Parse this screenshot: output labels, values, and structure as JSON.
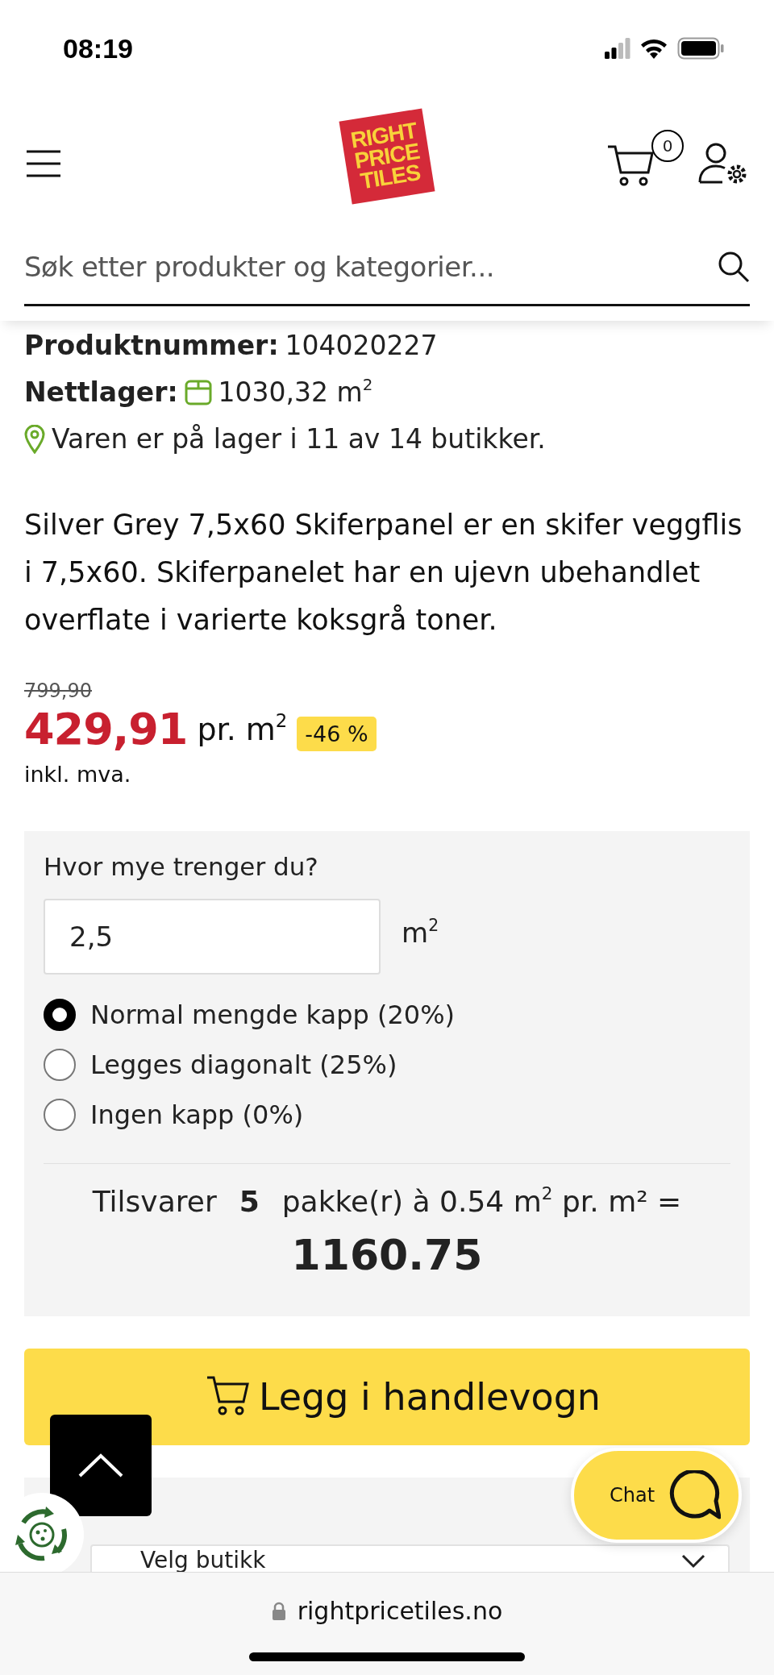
{
  "status_bar": {
    "time": "08:19"
  },
  "header": {
    "logo_lines": [
      "RIGHT",
      "PRICE",
      "TILES"
    ],
    "cart_count": "0"
  },
  "search": {
    "placeholder": "Søk etter produkter og kategorier..."
  },
  "product": {
    "number_label": "Produktnummer:",
    "number": "104020227",
    "stock_label": "Nettlager:",
    "stock": "1030,32 m$^{2}$",
    "availability": "Varen er på lager i 11 av 14 butikker.",
    "description": "Silver Grey 7,5x60 Skiferpanel er en skifer veggflis i 7,5x60. Skiferpanelet har en ujevn ubehandlet overflate i varierte koksgrå toner."
  },
  "price": {
    "old": "799,90",
    "current": "429,91",
    "unit": "pr. m$^{2}$",
    "discount": "-46 %",
    "vat_note": "inkl. mva."
  },
  "calculator": {
    "question": "Hvor mye trenger du?",
    "quantity": "2,5",
    "unit": "m$^{2}$",
    "options": [
      {
        "label": "Normal mengde kapp (20%)",
        "selected": true
      },
      {
        "label": "Legges diagonalt (25%)",
        "selected": false
      },
      {
        "label": "Ingen kapp (0%)",
        "selected": false
      }
    ],
    "result_prefix": "Tilsvarer",
    "packages": "5",
    "result_suffix": "pakke(r) à 0.54 m$^{2}$ pr. m² =",
    "total": "1160.75"
  },
  "add_to_cart": {
    "label": "Legg i handlevogn"
  },
  "store_select": {
    "label": "Velg butikk"
  },
  "chat": {
    "label": "Chat"
  },
  "browser": {
    "url": "rightpricetiles.no"
  }
}
